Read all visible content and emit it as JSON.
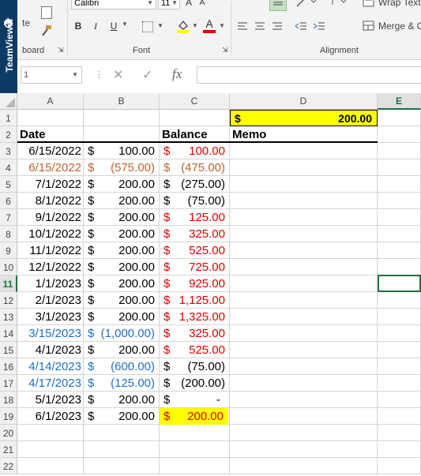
{
  "app": {
    "teamviewer_label": "TeamViewer"
  },
  "ribbon": {
    "clipboard": {
      "paste_label": "te",
      "group_label": "board"
    },
    "font": {
      "font_name": "Calibri",
      "font_size": "11",
      "grow_label": "A",
      "shrink_label": "A",
      "bold": "B",
      "italic": "I",
      "underline": "U",
      "group_label": "Font"
    },
    "alignment": {
      "wrap_text_label": "Wrap Text",
      "merge_label": "Merge & C",
      "group_label": "Alignment"
    }
  },
  "formula_bar": {
    "name_box_value": "1",
    "fx_label": "fx",
    "formula_value": ""
  },
  "columns": [
    "A",
    "B",
    "C",
    "D",
    "E"
  ],
  "rows": [
    "1",
    "2",
    "3",
    "4",
    "5",
    "6",
    "7",
    "8",
    "9",
    "10",
    "11",
    "12",
    "13",
    "14",
    "15",
    "16",
    "17",
    "18",
    "19",
    "20",
    "21",
    "22"
  ],
  "header_row": {
    "d1_symbol": "$",
    "d1_value": "200.00",
    "date": "Date",
    "balance": "Balance",
    "memo": "Memo"
  },
  "colors": {
    "highlight": "#ffff00",
    "red": "#e00000",
    "orange": "#c0622a",
    "blue": "#1f6fc2",
    "selection": "#1e7145"
  },
  "data_rows": [
    {
      "date": "6/15/2022",
      "amt_sym": "$",
      "amt": "100.00",
      "bal_sym": "$",
      "bal": "100.00",
      "row_color": "black",
      "bal_color": "red"
    },
    {
      "date": "6/15/2022",
      "amt_sym": "$",
      "amt": "(575.00)",
      "bal_sym": "$",
      "bal": "(475.00)",
      "row_color": "orange",
      "bal_color": "orange"
    },
    {
      "date": "7/1/2022",
      "amt_sym": "$",
      "amt": "200.00",
      "bal_sym": "$",
      "bal": "(275.00)",
      "row_color": "black",
      "bal_color": "black"
    },
    {
      "date": "8/1/2022",
      "amt_sym": "$",
      "amt": "200.00",
      "bal_sym": "$",
      "bal": "(75.00)",
      "row_color": "black",
      "bal_color": "black"
    },
    {
      "date": "9/1/2022",
      "amt_sym": "$",
      "amt": "200.00",
      "bal_sym": "$",
      "bal": "125.00",
      "row_color": "black",
      "bal_color": "red"
    },
    {
      "date": "10/1/2022",
      "amt_sym": "$",
      "amt": "200.00",
      "bal_sym": "$",
      "bal": "325.00",
      "row_color": "black",
      "bal_color": "red"
    },
    {
      "date": "11/1/2022",
      "amt_sym": "$",
      "amt": "200.00",
      "bal_sym": "$",
      "bal": "525.00",
      "row_color": "black",
      "bal_color": "red"
    },
    {
      "date": "12/1/2022",
      "amt_sym": "$",
      "amt": "200.00",
      "bal_sym": "$",
      "bal": "725.00",
      "row_color": "black",
      "bal_color": "red"
    },
    {
      "date": "1/1/2023",
      "amt_sym": "$",
      "amt": "200.00",
      "bal_sym": "$",
      "bal": "925.00",
      "row_color": "black",
      "bal_color": "red"
    },
    {
      "date": "2/1/2023",
      "amt_sym": "$",
      "amt": "200.00",
      "bal_sym": "$",
      "bal": "1,125.00",
      "row_color": "black",
      "bal_color": "red"
    },
    {
      "date": "3/1/2023",
      "amt_sym": "$",
      "amt": "200.00",
      "bal_sym": "$",
      "bal": "1,325.00",
      "row_color": "black",
      "bal_color": "red"
    },
    {
      "date": "3/15/2023",
      "amt_sym": "$",
      "amt": "(1,000.00)",
      "bal_sym": "$",
      "bal": "325.00",
      "row_color": "blue",
      "bal_color": "red"
    },
    {
      "date": "4/1/2023",
      "amt_sym": "$",
      "amt": "200.00",
      "bal_sym": "$",
      "bal": "525.00",
      "row_color": "black",
      "bal_color": "red"
    },
    {
      "date": "4/14/2023",
      "amt_sym": "$",
      "amt": "(600.00)",
      "bal_sym": "$",
      "bal": "(75.00)",
      "row_color": "blue",
      "bal_color": "black"
    },
    {
      "date": "4/17/2023",
      "amt_sym": "$",
      "amt": "(125.00)",
      "bal_sym": "$",
      "bal": "(200.00)",
      "row_color": "blue",
      "bal_color": "black"
    },
    {
      "date": "5/1/2023",
      "amt_sym": "$",
      "amt": "200.00",
      "bal_sym": "$",
      "bal": "-",
      "row_color": "black",
      "bal_color": "black"
    },
    {
      "date": "6/1/2023",
      "amt_sym": "$",
      "amt": "200.00",
      "bal_sym": "$",
      "bal": "200.00",
      "row_color": "black",
      "bal_color": "red",
      "bal_highlight": true
    }
  ]
}
